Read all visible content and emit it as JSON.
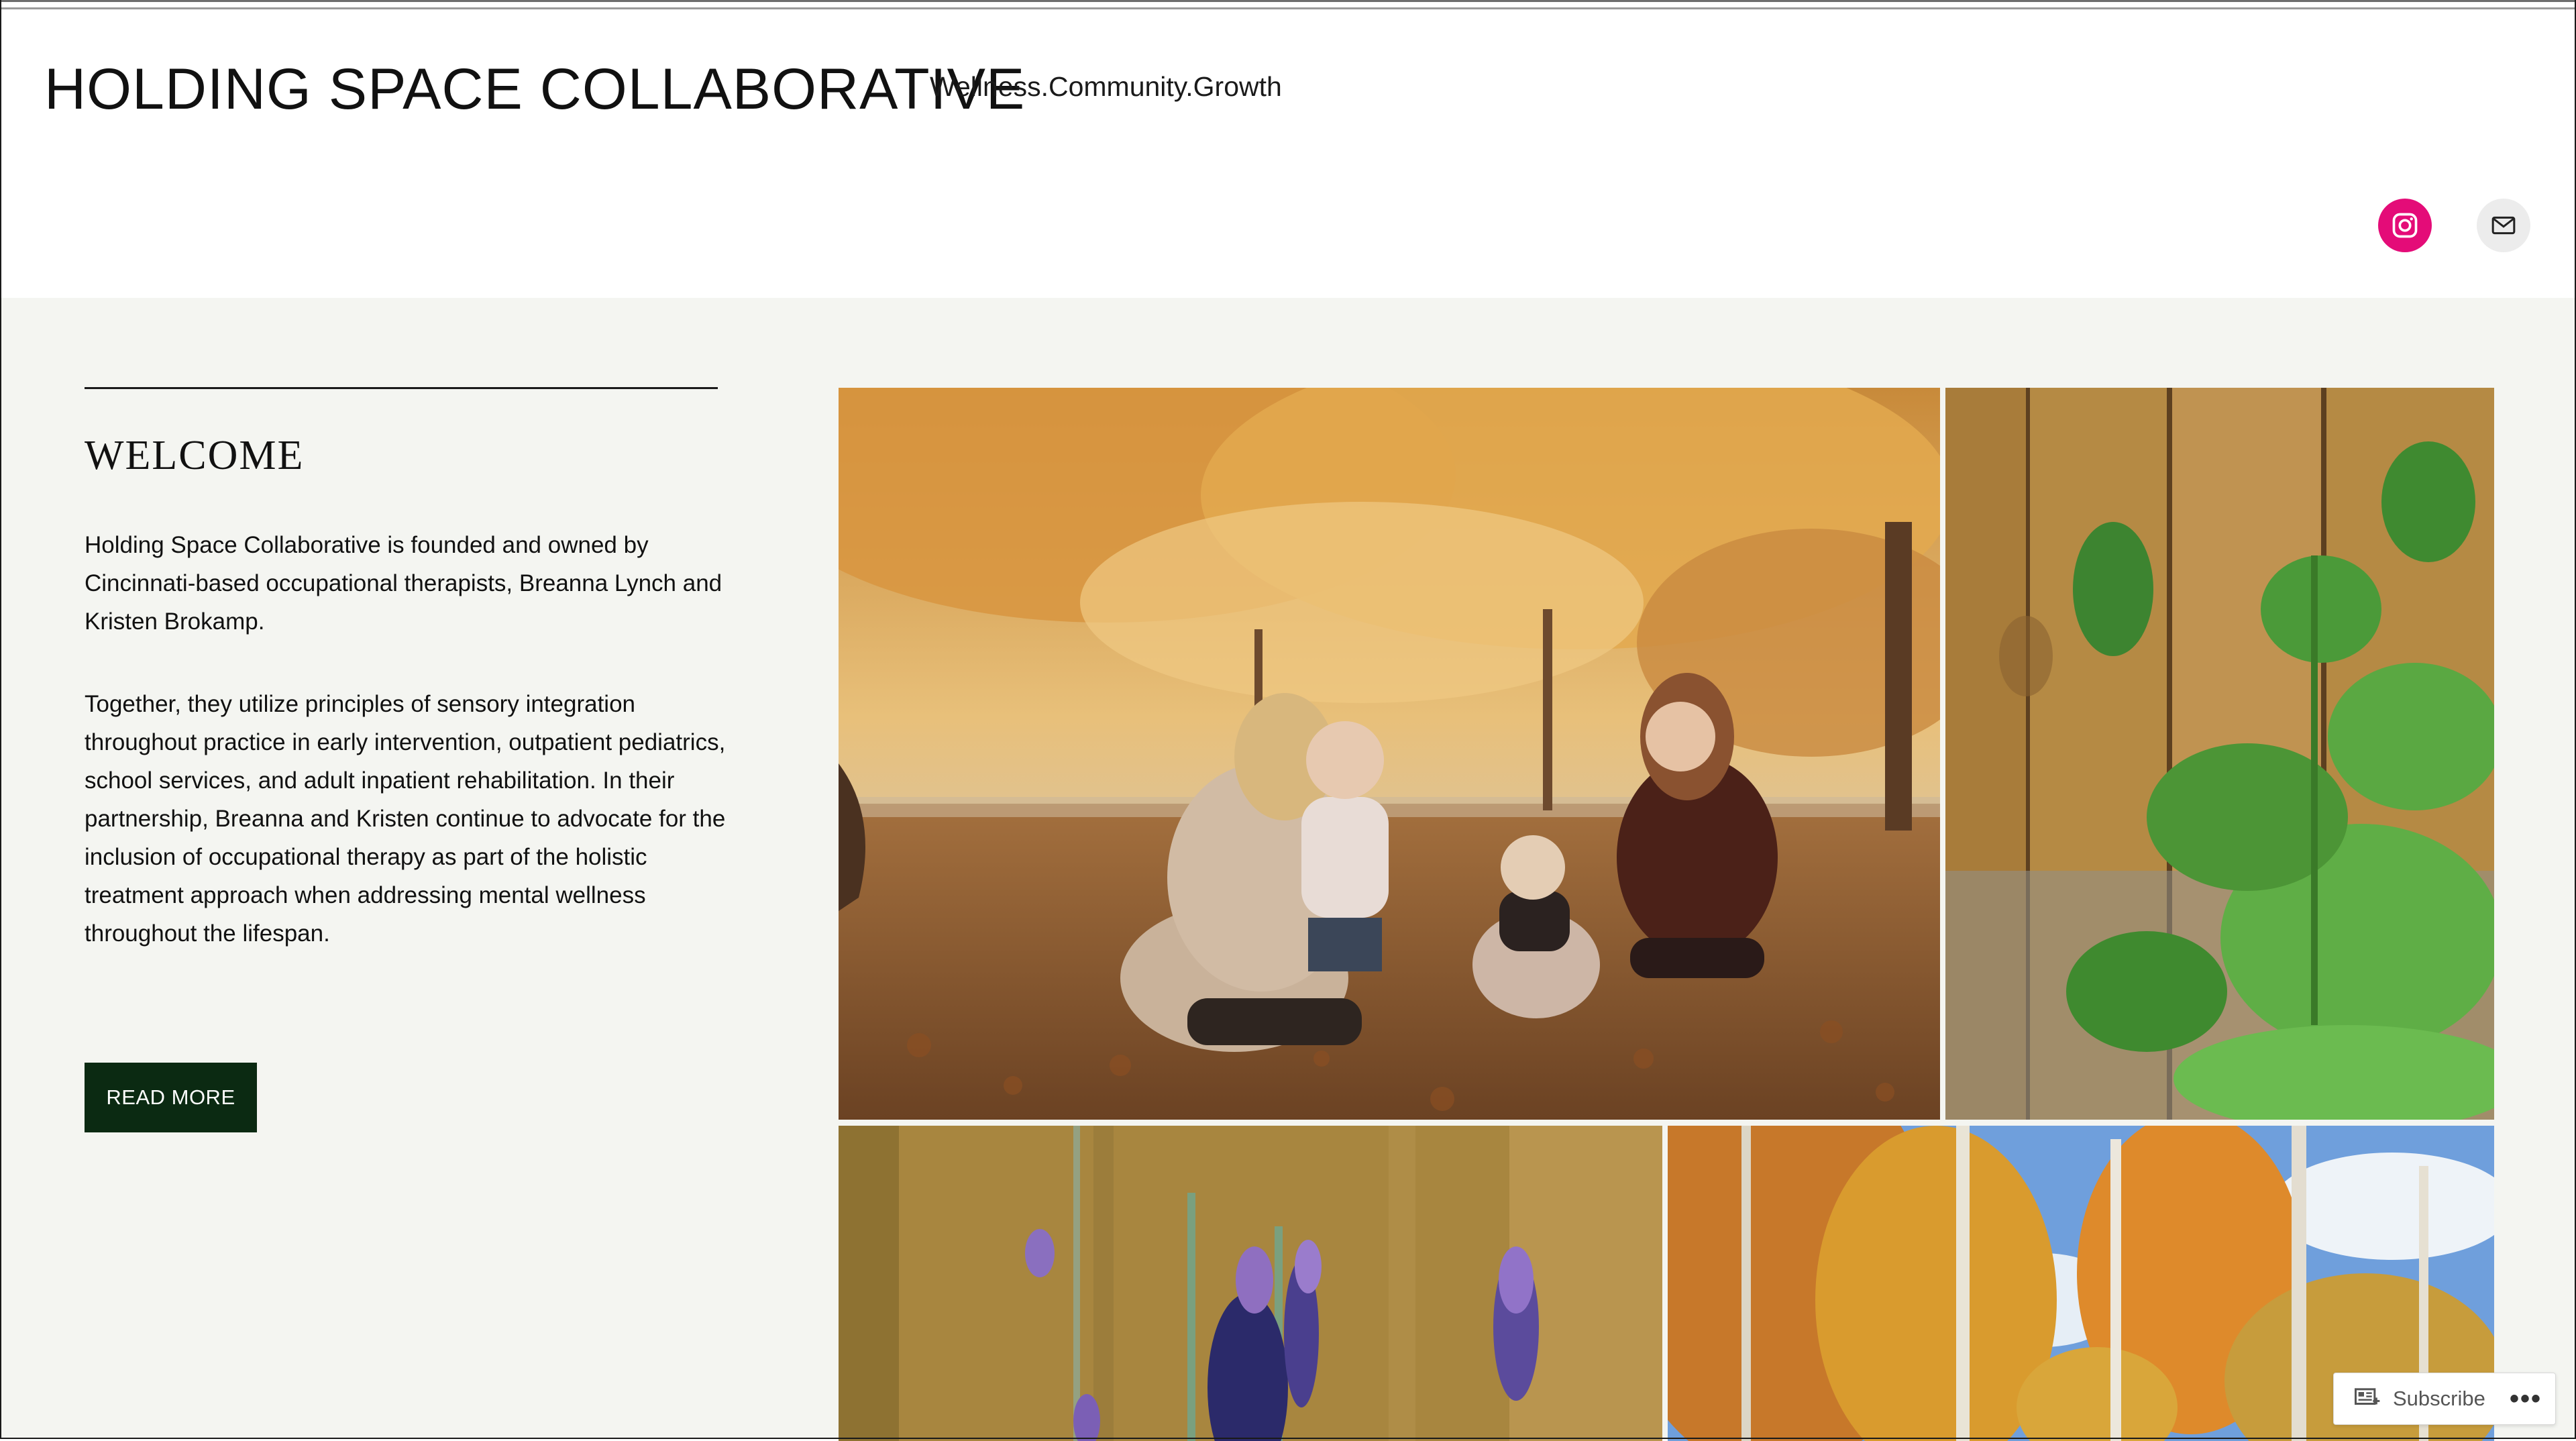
{
  "header": {
    "site_title": "HOLDING SPACE COLLABORATIVE",
    "tagline": "Wellness.Community.Growth"
  },
  "social": {
    "icons": [
      "instagram-icon",
      "mail-icon"
    ],
    "instagram_color": "#e40c78",
    "mail_bg": "#ececec"
  },
  "welcome": {
    "title": "WELCOME",
    "paragraph1": "Holding Space Collaborative is founded and owned by Cincinnati-based occupational therapists, Breanna Lynch and Kristen Brokamp.",
    "paragraph2": "Together, they utilize principles of sensory integration throughout practice in early intervention, outpatient pediatrics, school services, and adult inpatient rehabilitation. In their partnership, Breanna and Kristen continue to advocate for the inclusion of occupational therapy as part of the holistic treatment approach when addressing mental wellness throughout the lifespan.",
    "button_label": "READ MORE",
    "button_color": "#0b2a12"
  },
  "subscribe": {
    "label": "Subscribe",
    "more": "•••"
  },
  "colors": {
    "content_bg": "#f4f5f1",
    "header_bg": "#ffffff"
  }
}
